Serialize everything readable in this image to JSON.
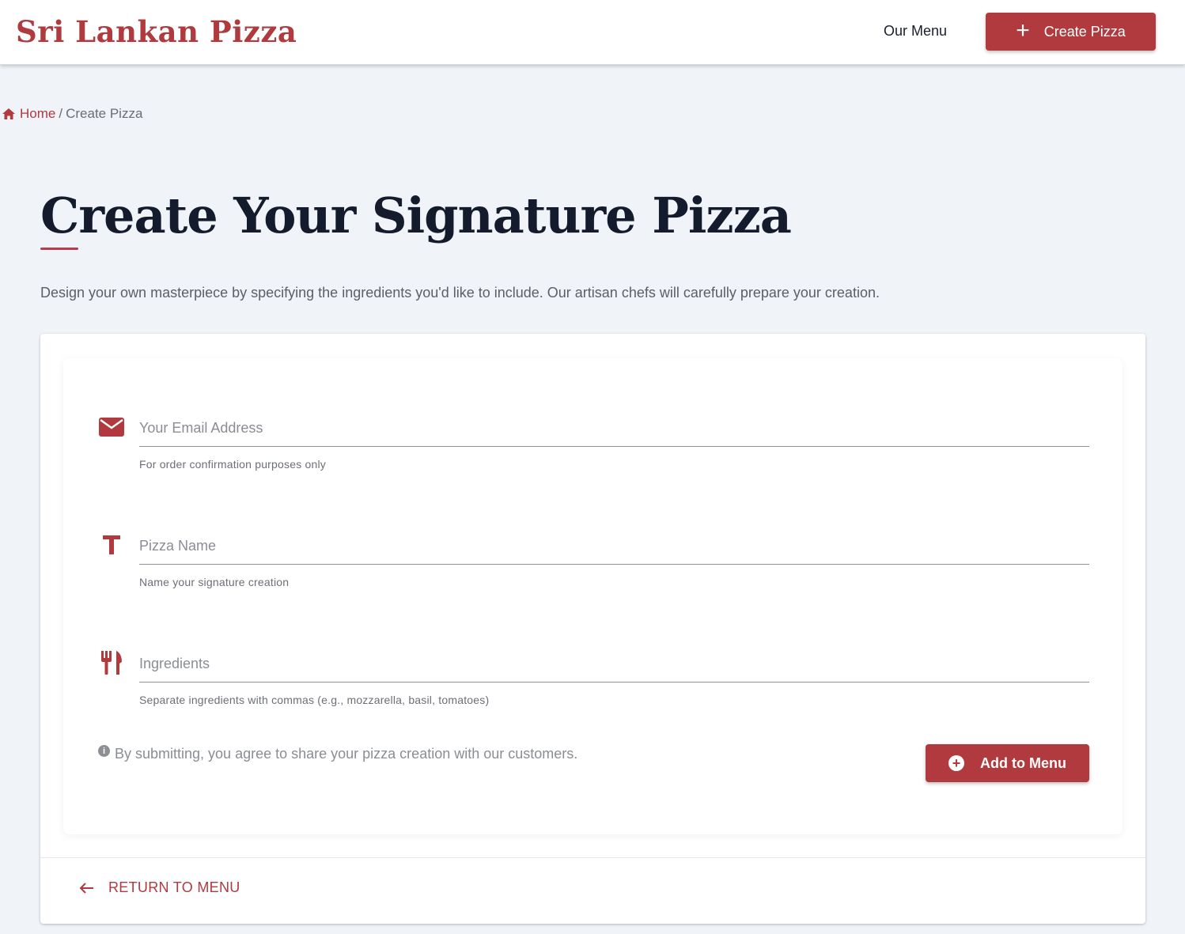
{
  "header": {
    "brand": "Sri Lankan Pizza",
    "nav_menu": "Our Menu",
    "create_button": "Create Pizza"
  },
  "breadcrumb": {
    "home": "Home",
    "separator": "/",
    "current": "Create Pizza"
  },
  "page": {
    "title": "Create Your Signature Pizza",
    "intro": "Design your own masterpiece by specifying the ingredients you'd like to include. Our artisan chefs will carefully prepare your creation."
  },
  "form": {
    "email": {
      "placeholder": "Your Email Address",
      "hint": "For order confirmation purposes only",
      "icon": "envelope-icon"
    },
    "name": {
      "placeholder": "Pizza Name",
      "hint": "Name your signature creation",
      "icon": "text-icon"
    },
    "ingredients": {
      "placeholder": "Ingredients",
      "hint": "Separate ingredients with commas (e.g., mozzarella, basil, tomatoes)",
      "icon": "utensils-icon"
    },
    "notice": "By submitting, you agree to share your pizza creation with our customers.",
    "submit_label": "Add to Menu"
  },
  "footer": {
    "return_label": "RETURN TO MENU"
  },
  "colors": {
    "accent": "#b03a3e",
    "background": "#f0f3f8",
    "title": "#141b2d"
  }
}
